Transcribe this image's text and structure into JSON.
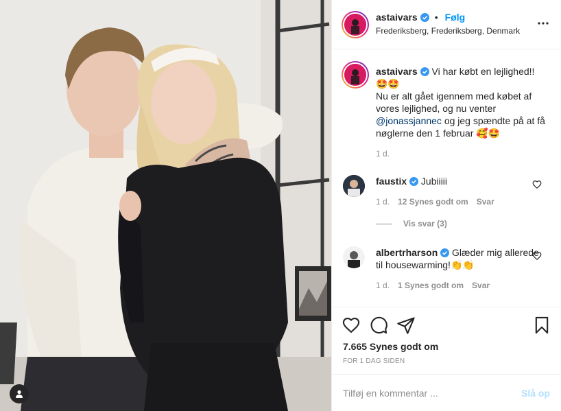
{
  "post": {
    "username": "astaivars",
    "follow_label": "Følg",
    "location": "Frederiksberg, Frederiksberg, Denmark",
    "caption_part1": "Vi har købt en lejlighed!! 🤩🤩",
    "caption_part2": "Nu er alt gået igennem med købet af vores lejlighed, og nu venter ",
    "caption_mention": "@jonassjannec",
    "caption_part3": " og jeg spændte på at få nøglerne den 1 februar 🥰🤩",
    "caption_age": "1 d."
  },
  "comments": [
    {
      "username": "faustix",
      "text": "Jubiiiii",
      "age": "1 d.",
      "likes": "12 Synes godt om",
      "reply_label": "Svar",
      "view_replies": "Vis svar (3)"
    },
    {
      "username": "albertrharson",
      "text": "Glæder mig allerede til housewarming!👏👏",
      "age": "1 d.",
      "likes": "1 Synes godt om",
      "reply_label": "Svar"
    }
  ],
  "footer": {
    "likes": "7.665 Synes godt om",
    "timestamp": "FOR 1 DAG SIDEN",
    "comment_placeholder": "Tilføj en kommentar ...",
    "post_label": "Slå op"
  },
  "icons": {
    "verified": "verified-badge-icon",
    "more": "more-options-icon",
    "like": "heart-icon",
    "comment": "comment-icon",
    "share": "paper-plane-icon",
    "save": "bookmark-icon",
    "tag": "user-tag-icon"
  },
  "colors": {
    "link_blue": "#0095f6",
    "mention_blue": "#00376b",
    "verified_blue": "#3897f0",
    "muted": "#8e8e8e",
    "post_disabled": "#b2dffc"
  }
}
